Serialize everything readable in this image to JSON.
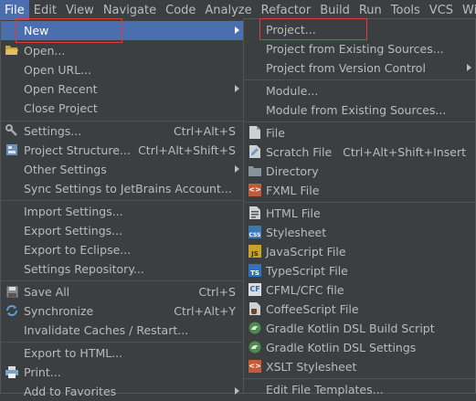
{
  "menubar": [
    "File",
    "Edit",
    "View",
    "Navigate",
    "Code",
    "Analyze",
    "Refactor",
    "Build",
    "Run",
    "Tools",
    "VCS",
    "Wind"
  ],
  "file_menu": {
    "new": "New",
    "open": "Open...",
    "open_url": "Open URL...",
    "open_recent": "Open Recent",
    "close_project": "Close Project",
    "settings": "Settings...",
    "settings_sc": "Ctrl+Alt+S",
    "project_structure": "Project Structure...",
    "project_structure_sc": "Ctrl+Alt+Shift+S",
    "other_settings": "Other Settings",
    "sync_settings": "Sync Settings to JetBrains Account...",
    "import_settings": "Import Settings...",
    "export_settings": "Export Settings...",
    "export_eclipse": "Export to Eclipse...",
    "settings_repository": "Settings Repository...",
    "save_all": "Save All",
    "save_all_sc": "Ctrl+S",
    "synchronize": "Synchronize",
    "synchronize_sc": "Ctrl+Alt+Y",
    "invalidate_caches": "Invalidate Caches / Restart...",
    "export_html": "Export to HTML...",
    "print": "Print...",
    "add_favorites": "Add to Favorites"
  },
  "new_menu": {
    "project": "Project...",
    "project_existing": "Project from Existing Sources...",
    "project_vcs": "Project from Version Control",
    "module": "Module...",
    "module_existing": "Module from Existing Sources...",
    "file": "File",
    "scratch_file": "Scratch File",
    "scratch_file_sc": "Ctrl+Alt+Shift+Insert",
    "directory": "Directory",
    "fxml_file": "FXML File",
    "html_file": "HTML File",
    "stylesheet": "Stylesheet",
    "javascript_file": "JavaScript File",
    "typescript_file": "TypeScript File",
    "cfml_file": "CFML/CFC file",
    "coffeescript_file": "CoffeeScript File",
    "gradle_kotlin_build": "Gradle Kotlin DSL Build Script",
    "gradle_kotlin_settings": "Gradle Kotlin DSL Settings",
    "xslt_stylesheet": "XSLT Stylesheet",
    "edit_file_templates": "Edit File Templates..."
  },
  "icons": {
    "css_text": "CSS",
    "js_text": "JS",
    "ts_text": "TS",
    "cf_text": "CF",
    "xml_text": "<>"
  },
  "colors": {
    "menu_bg": "#3c3f41",
    "selection": "#4b6eaf",
    "highlight_box": "#e03a3a"
  }
}
